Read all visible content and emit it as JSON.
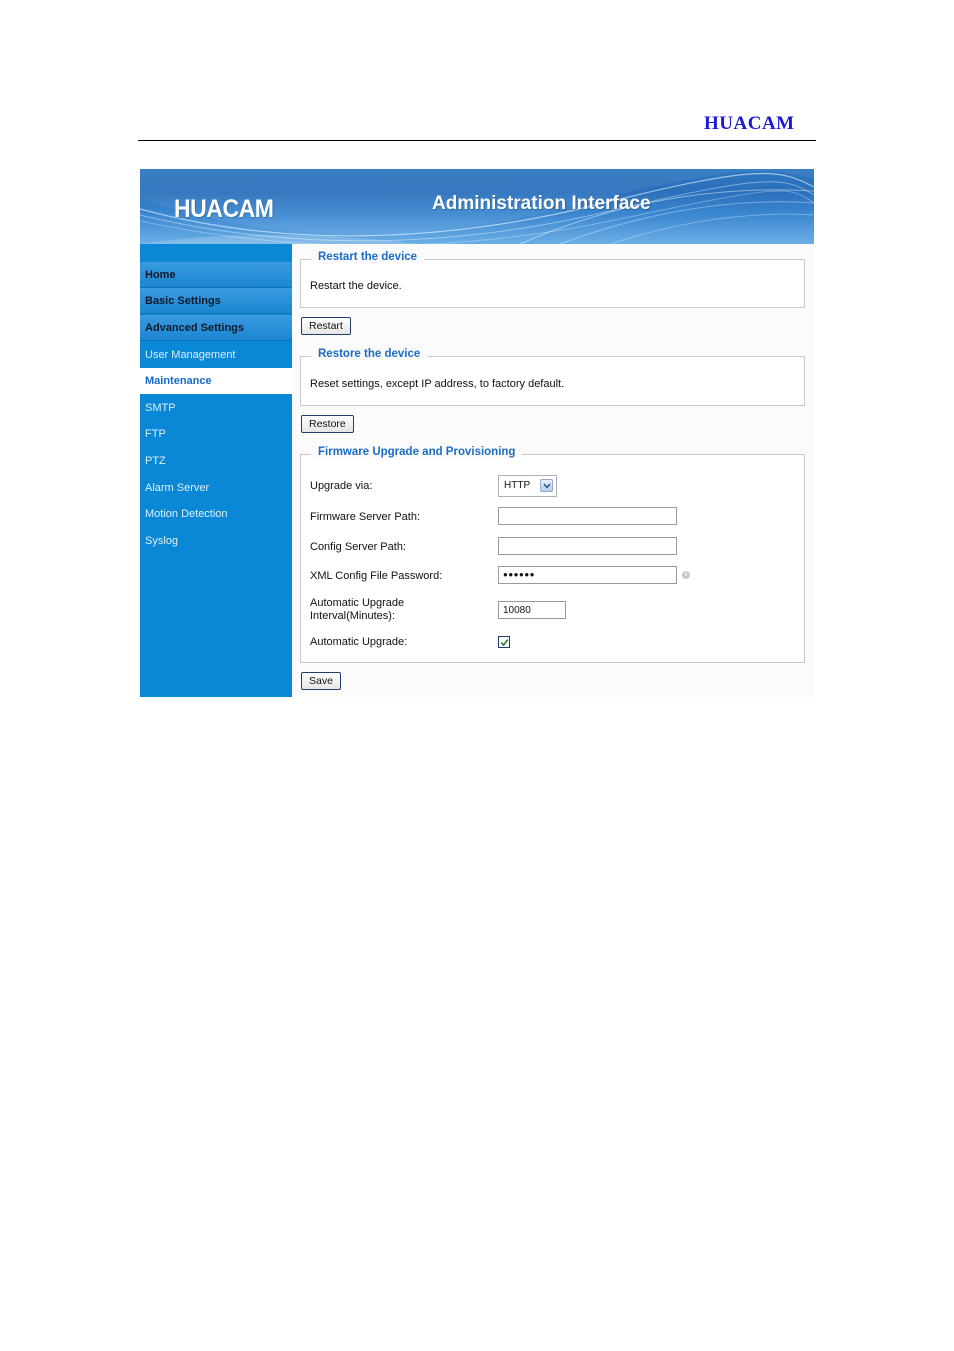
{
  "document": {
    "brand": "HUACAM"
  },
  "banner": {
    "logo": "HUACAM",
    "title": "Administration Interface"
  },
  "sidebar": {
    "items": [
      {
        "label": "Home"
      },
      {
        "label": "Basic Settings"
      },
      {
        "label": "Advanced Settings"
      },
      {
        "label": "User Management"
      },
      {
        "label": "Maintenance"
      },
      {
        "label": "SMTP"
      },
      {
        "label": "FTP"
      },
      {
        "label": "PTZ"
      },
      {
        "label": "Alarm Server"
      },
      {
        "label": "Motion Detection"
      },
      {
        "label": "Syslog"
      }
    ]
  },
  "restart": {
    "legend": "Restart the device",
    "description": "Restart the device.",
    "button_label": "Restart"
  },
  "restore": {
    "legend": "Restore the device",
    "description": "Reset settings, except IP address, to factory default.",
    "button_label": "Restore"
  },
  "firmware": {
    "legend": "Firmware Upgrade and Provisioning",
    "upgrade_via_label": "Upgrade via:",
    "upgrade_via_value": "HTTP",
    "firmware_path_label": "Firmware Server Path:",
    "firmware_path_value": "",
    "config_path_label": "Config Server Path:",
    "config_path_value": "",
    "xml_password_label": "XML Config File Password:",
    "xml_password_value": "●●●●●●",
    "interval_label_line1": "Automatic Upgrade",
    "interval_label_line2": "Interval(Minutes):",
    "interval_value": "10080",
    "auto_upgrade_label": "Automatic Upgrade:",
    "auto_upgrade_checked": true
  },
  "save_button_label": "Save",
  "colors": {
    "sidebar": "#0a88d6",
    "legend": "#1a6cc6",
    "brand": "#1a1ad0"
  }
}
